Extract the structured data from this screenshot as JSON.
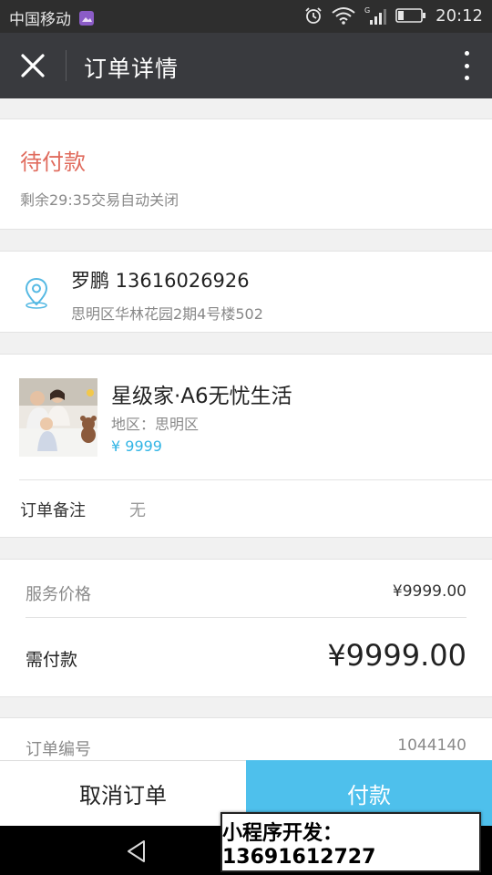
{
  "status_bar": {
    "carrier": "中国移动",
    "time": "20:12",
    "icons": [
      "gallery-notification-icon",
      "alarm-icon",
      "wifi-icon",
      "signal-icon",
      "battery-icon"
    ]
  },
  "header": {
    "title": "订单详情",
    "close_icon": "close-icon",
    "more_icon": "more-vertical-icon"
  },
  "order_status": {
    "title": "待付款",
    "subtitle": "剩余29:35交易自动关闭"
  },
  "address": {
    "name_phone": "罗鹏 13616026926",
    "detail": "思明区华林花园2期4号楼502",
    "icon": "location-pin-icon"
  },
  "product": {
    "name": "星级家·A6无忧生活",
    "region": "地区：思明区",
    "price": "¥ 9999"
  },
  "remark": {
    "label": "订单备注",
    "value": "无"
  },
  "pricing": {
    "service_label": "服务价格",
    "service_value": "¥9999.00",
    "due_label": "需付款",
    "due_value": "¥9999.00"
  },
  "order_info": {
    "number_label": "订单编号",
    "number_value": "1044140"
  },
  "actions": {
    "cancel_label": "取消订单",
    "pay_label": "付款"
  },
  "overlay": {
    "promo_text": "小程序开发：13691612727"
  },
  "colors": {
    "status_red": "#e06b5d",
    "accent_blue": "#4ec0ec",
    "price_blue": "#33b5e5",
    "titlebar_bg": "#393a3e"
  }
}
